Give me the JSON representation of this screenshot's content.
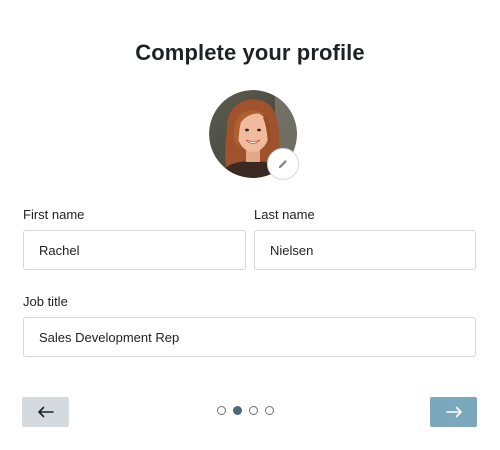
{
  "header": {
    "title": "Complete your profile"
  },
  "avatar": {
    "alt": "Profile photo",
    "edit_icon": "pencil-icon"
  },
  "form": {
    "first_name": {
      "label": "First name",
      "value": "Rachel"
    },
    "last_name": {
      "label": "Last name",
      "value": "Nielsen"
    },
    "job_title": {
      "label": "Job title",
      "value": "Sales Development Rep"
    }
  },
  "navigation": {
    "back_icon": "arrow-left-icon",
    "next_icon": "arrow-right-icon",
    "steps_total": 4,
    "current_step": 2
  },
  "colors": {
    "next_button": "#7ba8bd",
    "back_button": "#d5dadf",
    "active_dot": "#4b6a7a"
  }
}
